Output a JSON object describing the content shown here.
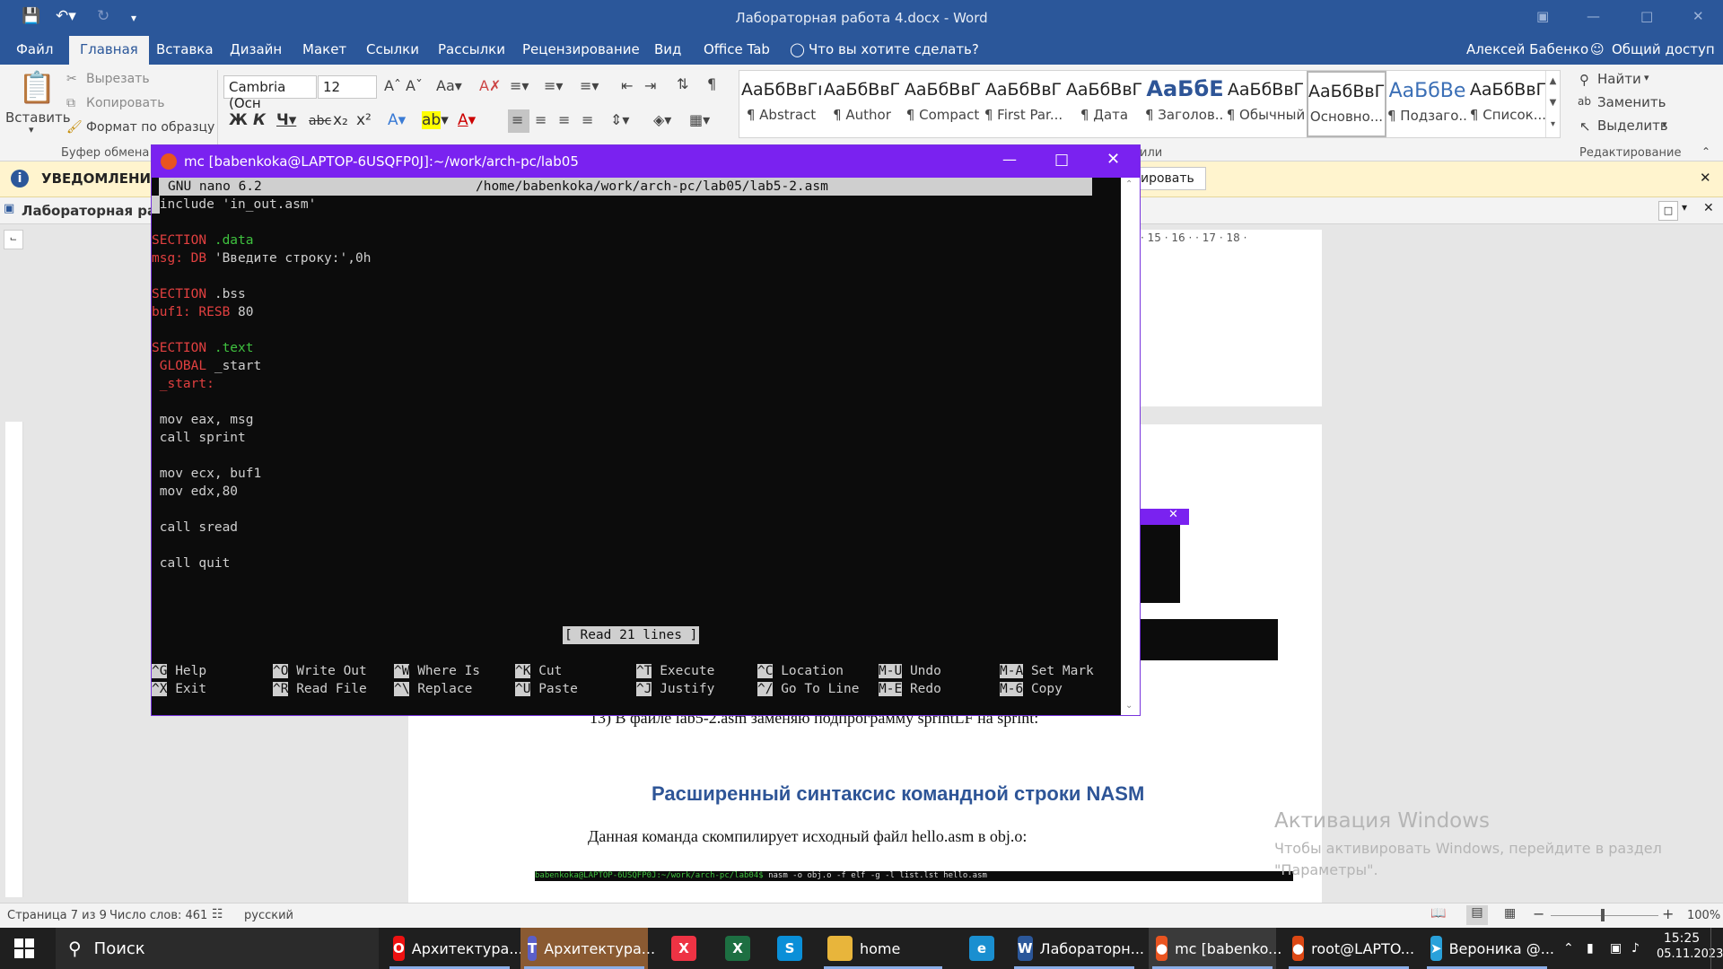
{
  "word": {
    "title": "Лабораторная работа 4.docx - Word",
    "tabs": [
      "Файл",
      "Главная",
      "Вставка",
      "Дизайн",
      "Макет",
      "Ссылки",
      "Рассылки",
      "Рецензирование",
      "Вид",
      "Office Tab"
    ],
    "tell_me": "Что вы хотите сделать?",
    "user": "Алексей Бабенко",
    "share": "Общий доступ",
    "clipboard": {
      "paste": "Вставить",
      "cut": "Вырезать",
      "copy": "Копировать",
      "format_painter": "Формат по образцу",
      "group": "Буфер обмена"
    },
    "font": {
      "name": "Cambria (Осн",
      "size": "12"
    },
    "group_labels": {
      "styles_tail": "или",
      "editing": "Редактирование"
    },
    "styles": [
      {
        "preview": "АаБбВвГг,",
        "name": "¶ Abstract"
      },
      {
        "preview": "АаБбВвГ",
        "name": "¶ Author"
      },
      {
        "preview": "АаБбВвГ",
        "name": "¶ Compact"
      },
      {
        "preview": "АаБбВвГ",
        "name": "¶ First Par..."
      },
      {
        "preview": "АаБбВвГ",
        "name": "¶ Дата"
      },
      {
        "preview": "АаБбЕ",
        "name": "¶ Заголов..."
      },
      {
        "preview": "АаБбВвГ",
        "name": "¶ Обычный"
      },
      {
        "preview": "АаБбВвГ",
        "name": "Основно..."
      },
      {
        "preview": "АаБбВе",
        "name": "¶ Подзаго..."
      },
      {
        "preview": "АаБбВвГ",
        "name": "¶ Список..."
      }
    ],
    "editing": {
      "find": "Найти",
      "replace": "Заменить",
      "select": "Выделить"
    },
    "notification": {
      "label": "УВЕДОМЛЕНИЕ П",
      "button_tail": "ировать"
    },
    "doc_tab": "Лабораторная рабо",
    "ruler_marks": [
      "15",
      "16",
      "17",
      "18"
    ],
    "doc": {
      "caption": "13) В файле lab5-2.asm заменяю подпрограмму sprintLF на sprint:",
      "heading": "Расширенный синтаксис командной строки NASM",
      "para": "Данная команда скомпилирует исходный файл hello.asm в obj.o:",
      "cmd_prompt": "babenkoka@LAPTOP-6USQFP0J:~/work/arch-pc/lab04$",
      "cmd_text": " nasm -o obj.o -f elf -g -l list.lst hello.asm"
    },
    "activation": {
      "title": "Активация Windows",
      "line1": "Чтобы активировать Windows, перейдите в раздел",
      "line2": "\"Параметры\"."
    },
    "status": {
      "page": "Страница 7 из 9",
      "words": "Число слов: 461",
      "lang": "русский",
      "zoom": "100%"
    }
  },
  "terminal": {
    "title": "mc [babenkoka@LAPTOP-6USQFP0J]:~/work/arch-pc/lab05",
    "nano_version": "GNU nano 6.2",
    "file_path": "/home/babenkoka/work/arch-pc/lab05/lab5-2.asm",
    "status_msg": "[ Read 21 lines ]",
    "lines": [
      [
        {
          "t": "%include 'in_out.asm'",
          "c": "kw"
        }
      ],
      [],
      [
        {
          "t": "SECTION ",
          "c": "kred"
        },
        {
          "t": ".data",
          "c": "kgrn"
        }
      ],
      [
        {
          "t": "msg: DB ",
          "c": "kred"
        },
        {
          "t": "'Введите строку:',0h",
          "c": "kw"
        }
      ],
      [],
      [
        {
          "t": "SECTION ",
          "c": "kred"
        },
        {
          "t": ".bss",
          "c": "kw"
        }
      ],
      [
        {
          "t": "buf1: RESB ",
          "c": "kred"
        },
        {
          "t": "80",
          "c": "kw"
        }
      ],
      [],
      [
        {
          "t": "SECTION ",
          "c": "kred"
        },
        {
          "t": ".text",
          "c": "kgrn"
        }
      ],
      [
        {
          "t": " GLOBAL ",
          "c": "kred"
        },
        {
          "t": "_start",
          "c": "kw"
        }
      ],
      [
        {
          "t": " _start:",
          "c": "kred"
        }
      ],
      [],
      [
        {
          "t": " mov eax, msg",
          "c": "kw"
        }
      ],
      [
        {
          "t": " call sprint",
          "c": "kw"
        }
      ],
      [],
      [
        {
          "t": " mov ecx, buf1",
          "c": "kw"
        }
      ],
      [
        {
          "t": " mov edx,80",
          "c": "kw"
        }
      ],
      [],
      [
        {
          "t": " call sread",
          "c": "kw"
        }
      ],
      [],
      [
        {
          "t": " call quit",
          "c": "kw"
        }
      ]
    ],
    "shortcuts_row1": [
      [
        "^G",
        "Help"
      ],
      [
        "^O",
        "Write Out"
      ],
      [
        "^W",
        "Where Is"
      ],
      [
        "^K",
        "Cut"
      ],
      [
        "^T",
        "Execute"
      ],
      [
        "^C",
        "Location"
      ],
      [
        "M-U",
        "Undo"
      ],
      [
        "M-A",
        "Set Mark"
      ]
    ],
    "shortcuts_row2": [
      [
        "^X",
        "Exit"
      ],
      [
        "^R",
        "Read File"
      ],
      [
        "^\\",
        "Replace"
      ],
      [
        "^U",
        "Paste"
      ],
      [
        "^J",
        "Justify"
      ],
      [
        "^/",
        "Go To Line"
      ],
      [
        "M-E",
        "Redo"
      ],
      [
        "M-6",
        "Copy"
      ]
    ]
  },
  "taskbar": {
    "search": "Поиск",
    "items": [
      {
        "icon": "opera-icon",
        "label": "Архитектура..."
      },
      {
        "icon": "teams-icon",
        "label": "Архитектура..."
      },
      {
        "icon": "xmind-icon",
        "label": ""
      },
      {
        "icon": "excel-icon",
        "label": ""
      },
      {
        "icon": "skype-icon",
        "label": ""
      },
      {
        "icon": "folder-icon",
        "label": "home"
      },
      {
        "icon": "edge-icon",
        "label": ""
      },
      {
        "icon": "word-icon",
        "label": "Лабораторн..."
      },
      {
        "icon": "ubuntu-icon",
        "label": "mc [babenko..."
      },
      {
        "icon": "ubuntu-terminal-icon",
        "label": "root@LAPTO..."
      },
      {
        "icon": "telegram-icon",
        "label": "Вероника @..."
      }
    ],
    "time": "15:25",
    "date": "05.11.2023"
  }
}
